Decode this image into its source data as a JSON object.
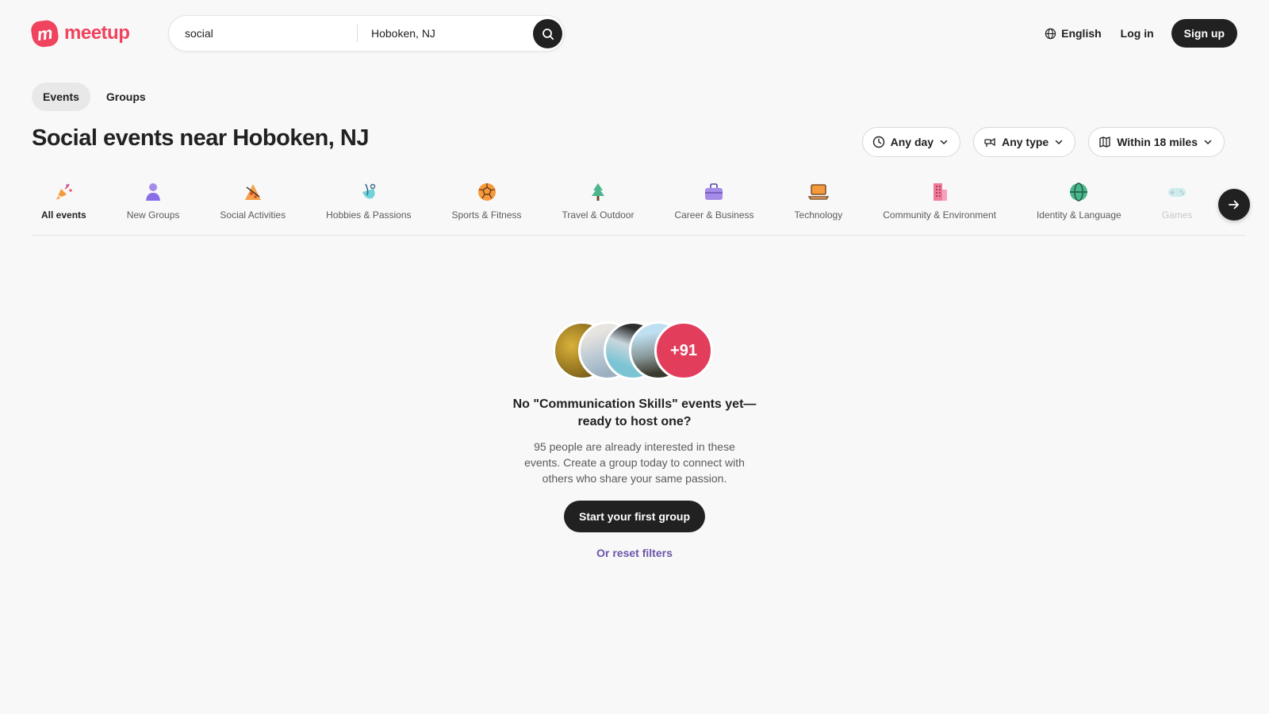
{
  "brand": {
    "name": "meetup",
    "mark": "m",
    "color": "#f0435e"
  },
  "search": {
    "keyword_value": "social",
    "location_value": "Hoboken, NJ",
    "button_icon": "search-icon"
  },
  "header": {
    "language_icon": "globe-icon",
    "language_label": "English",
    "login_label": "Log in",
    "signup_label": "Sign up"
  },
  "tabs": [
    {
      "label": "Events",
      "active": true
    },
    {
      "label": "Groups",
      "active": false
    }
  ],
  "page_title": "Social events near Hoboken, NJ",
  "filters": [
    {
      "icon": "clock-icon",
      "label": "Any day"
    },
    {
      "icon": "event-type-icon",
      "label": "Any type"
    },
    {
      "icon": "map-icon",
      "label": "Within 18 miles"
    }
  ],
  "categories": [
    {
      "label": "All events",
      "icon": "party-popper-icon",
      "active": true
    },
    {
      "label": "New Groups",
      "icon": "person-icon"
    },
    {
      "label": "Social Activities",
      "icon": "pizza-slice-icon"
    },
    {
      "label": "Hobbies & Passions",
      "icon": "hobby-icon"
    },
    {
      "label": "Sports & Fitness",
      "icon": "ball-icon"
    },
    {
      "label": "Travel & Outdoor",
      "icon": "tree-icon"
    },
    {
      "label": "Career & Business",
      "icon": "briefcase-icon"
    },
    {
      "label": "Technology",
      "icon": "laptop-icon"
    },
    {
      "label": "Community & Environment",
      "icon": "building-icon"
    },
    {
      "label": "Identity & Language",
      "icon": "globe-icon"
    },
    {
      "label": "Games",
      "icon": "gamepad-icon",
      "faded": true
    }
  ],
  "empty_state": {
    "more_count": "+91",
    "title": "No \"Communication Skills\" events yet—ready to host one?",
    "text": "95 people are already interested in these events. Create a group today to connect with others who share your same passion.",
    "cta_label": "Start your first group",
    "reset_label": "Or reset filters"
  },
  "colors": {
    "accent": "#f0435e",
    "dark": "#212121",
    "link": "#6b55a8",
    "background": "#f8f8f8"
  }
}
